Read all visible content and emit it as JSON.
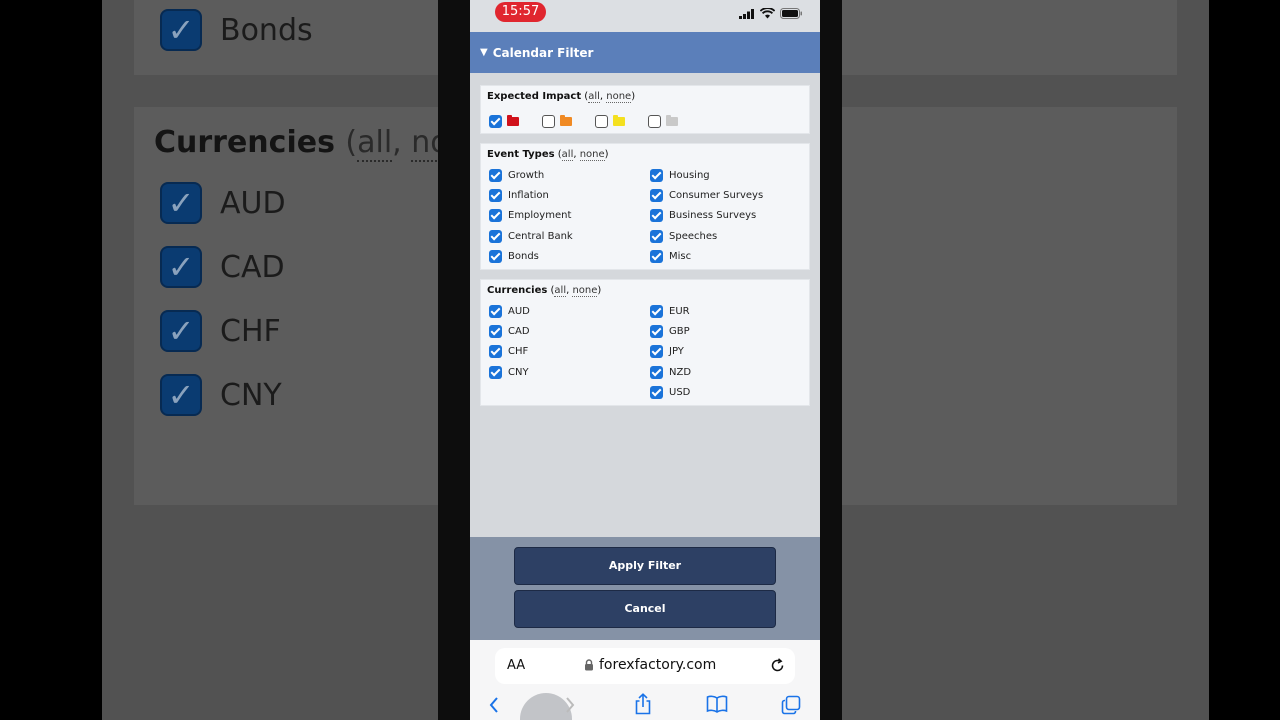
{
  "background": {
    "items_top": [
      {
        "label": "Bonds"
      }
    ],
    "currencies_heading": {
      "title": "Currencies",
      "all": "all",
      "none": "no"
    },
    "currencies": [
      {
        "label": "AUD"
      },
      {
        "label": "CAD"
      },
      {
        "label": "CHF"
      },
      {
        "label": "CNY"
      }
    ]
  },
  "status_bar": {
    "time": "15:57"
  },
  "filter": {
    "title": "Calendar Filter",
    "impact": {
      "title": "Expected Impact",
      "all": "all",
      "none": "none",
      "levels": [
        {
          "color": "#d0111b",
          "checked": true
        },
        {
          "color": "#f08a24",
          "checked": false
        },
        {
          "color": "#f4e01f",
          "checked": false
        },
        {
          "color": "#c9c9c9",
          "checked": false
        }
      ]
    },
    "event_types": {
      "title": "Event Types",
      "all": "all",
      "none": "none",
      "left": [
        "Growth",
        "Inflation",
        "Employment",
        "Central Bank",
        "Bonds"
      ],
      "right": [
        "Housing",
        "Consumer Surveys",
        "Business Surveys",
        "Speeches",
        "Misc"
      ]
    },
    "currencies": {
      "title": "Currencies",
      "all": "all",
      "none": "none",
      "left": [
        "AUD",
        "CAD",
        "CHF",
        "CNY"
      ],
      "right": [
        "EUR",
        "GBP",
        "JPY",
        "NZD",
        "USD"
      ]
    },
    "apply_label": "Apply Filter",
    "cancel_label": "Cancel"
  },
  "browser": {
    "aa_label": "AA",
    "url": "forexfactory.com"
  },
  "colors": {
    "header": "#5b7fba",
    "button": "#2d4064",
    "checkbox": "#1a73d9"
  }
}
